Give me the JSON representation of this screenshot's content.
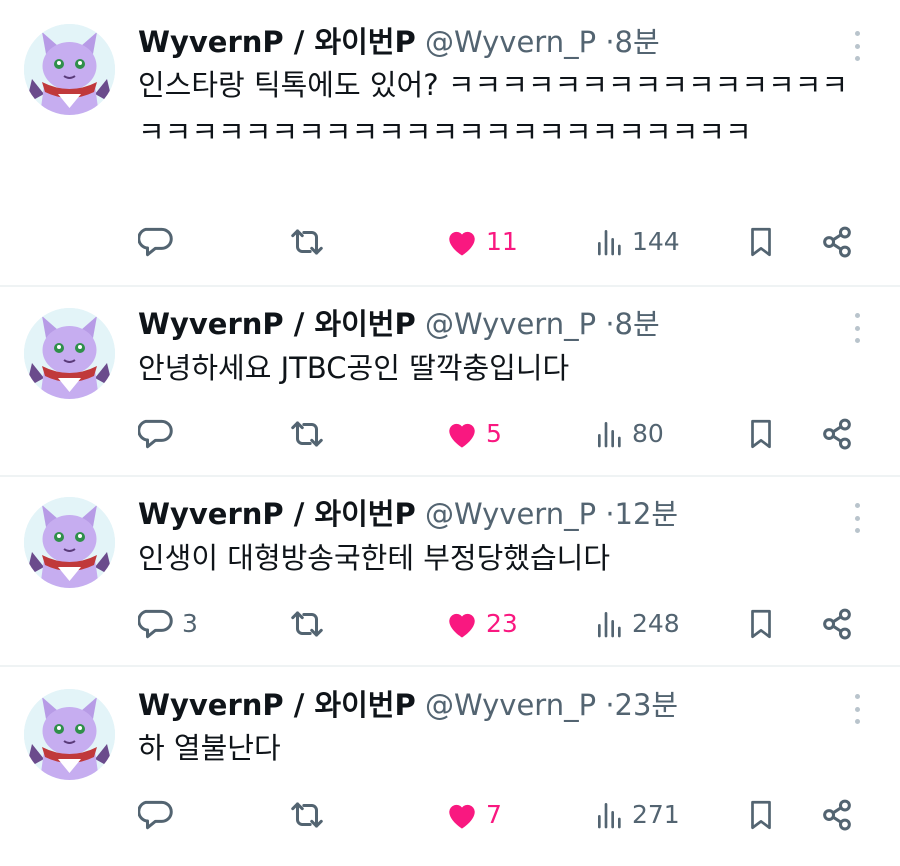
{
  "tweets": [
    {
      "author_name": "WyvernP / 와이번P",
      "handle": "@Wyvern_P",
      "separator": "·",
      "time": "8분",
      "text": "인스타랑 틱톡에도 있어? ㅋㅋㅋㅋㅋㅋㅋㅋㅋㅋㅋㅋㅋㅋㅋㅋㅋㅋㅋㅋㅋㅋㅋㅋㅋㅋㅋㅋㅋㅋㅋㅋㅋㅋㅋㅋㅋㅋ",
      "replies": "",
      "likes": "11",
      "views": "144"
    },
    {
      "author_name": "WyvernP / 와이번P",
      "handle": "@Wyvern_P",
      "separator": "·",
      "time": "8분",
      "text": "안녕하세요 JTBC공인 딸깍충입니다",
      "replies": "",
      "likes": "5",
      "views": "80"
    },
    {
      "author_name": "WyvernP / 와이번P",
      "handle": "@Wyvern_P",
      "separator": "·",
      "time": "12분",
      "text": "인생이 대형방송국한테 부정당했습니다",
      "replies": "3",
      "likes": "23",
      "views": "248"
    },
    {
      "author_name": "WyvernP / 와이번P",
      "handle": "@Wyvern_P",
      "separator": "·",
      "time": "23분",
      "text": "하 열불난다",
      "replies": "",
      "likes": "7",
      "views": "271"
    }
  ],
  "icons": {
    "reply": "reply-icon",
    "retweet": "retweet-icon",
    "like": "heart-icon",
    "views": "views-icon",
    "bookmark": "bookmark-icon",
    "share": "share-icon",
    "more": "more-options-icon"
  },
  "colors": {
    "like_active": "#f91880",
    "secondary_text": "#536471",
    "primary_text": "#0f1419",
    "avatar_purple": "#b79be6",
    "divider": "#eff3f4"
  }
}
